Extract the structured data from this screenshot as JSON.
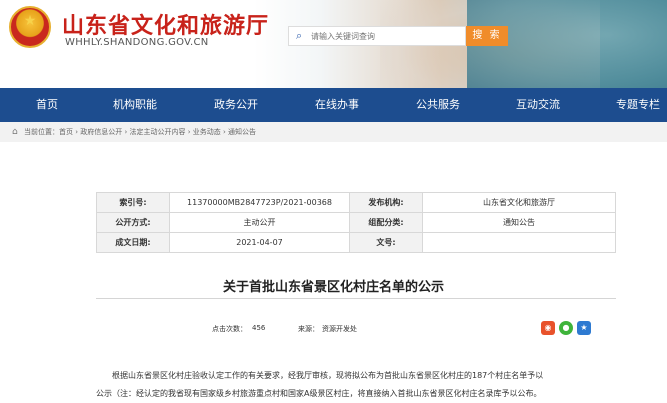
{
  "header": {
    "site_title": "山东省文化和旅游厅",
    "site_domain": "WHHLY.SHANDONG.GOV.CN",
    "search_placeholder": "请输入关键词查询",
    "search_button": "搜 索"
  },
  "nav": {
    "items": [
      "首页",
      "机构职能",
      "政务公开",
      "在线办事",
      "公共服务",
      "互动交流",
      "专题专栏"
    ]
  },
  "breadcrumb": {
    "text": "当前位置：首页 › 政府信息公开 › 法定主动公开内容 › 业务动态 › 通知公告"
  },
  "meta": {
    "index_label": "索引号:",
    "index_value": "11370000MB2847723P/2021-00368",
    "publisher_label": "发布机构:",
    "publisher_value": "山东省文化和旅游厅",
    "method_label": "公开方式:",
    "method_value": "主动公开",
    "category_label": "组配分类:",
    "category_value": "通知公告",
    "date_label": "成文日期:",
    "date_value": "2021-04-07",
    "docno_label": "文号:",
    "docno_value": ""
  },
  "article": {
    "title": "关于首批山东省景区化村庄名单的公示",
    "views_label": "点击次数：",
    "views_value": "456",
    "source_label": "来源：",
    "source_value": "资源开发处",
    "body_line1": "根据山东省景区化村庄验收认定工作的有关要求，经我厅审核，现将拟公布为首批山东省景区化村庄的187个村庄名单予以",
    "body_line2": "公示（注：经认定的我省现有国家级乡村旅游重点村和国家A级景区村庄，将直接纳入首批山东省景区化村庄名录库予以公布。"
  },
  "colors": {
    "nav_bg": "#1d4d8f",
    "title_red": "#c8221a",
    "search_orange": "#f08c2a"
  }
}
